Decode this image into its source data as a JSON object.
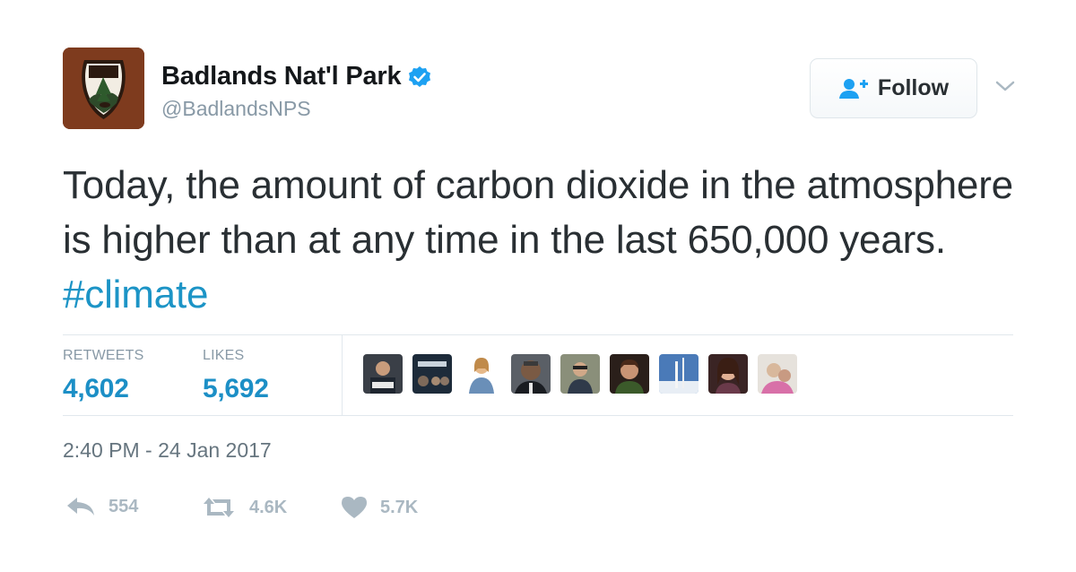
{
  "user": {
    "display_name": "Badlands Nat'l Park",
    "screen_name": "@BadlandsNPS",
    "verified": true,
    "avatar_icon": "nps-arrowhead-icon"
  },
  "follow_button": {
    "label": "Follow",
    "icon": "add-user-icon"
  },
  "tweet": {
    "text": "Today, the amount of carbon dioxide in the atmosphere is higher than at any time in the last 650,000 years.",
    "hashtag": "#climate"
  },
  "stats": {
    "retweets_label": "RETWEETS",
    "retweets_value": "4,602",
    "likes_label": "LIKES",
    "likes_value": "5,692"
  },
  "timestamp": "2:40 PM - 24 Jan 2017",
  "actions": {
    "reply_count": "554",
    "retweet_count": "4.6K",
    "like_count": "5.7K"
  },
  "colors": {
    "link": "#1c94c6",
    "stat_value": "#1c8fc6",
    "muted": "#8899a6",
    "action_gray": "#aab8c2",
    "verified": "#1da1f2",
    "follow_icon": "#1da1f2"
  }
}
